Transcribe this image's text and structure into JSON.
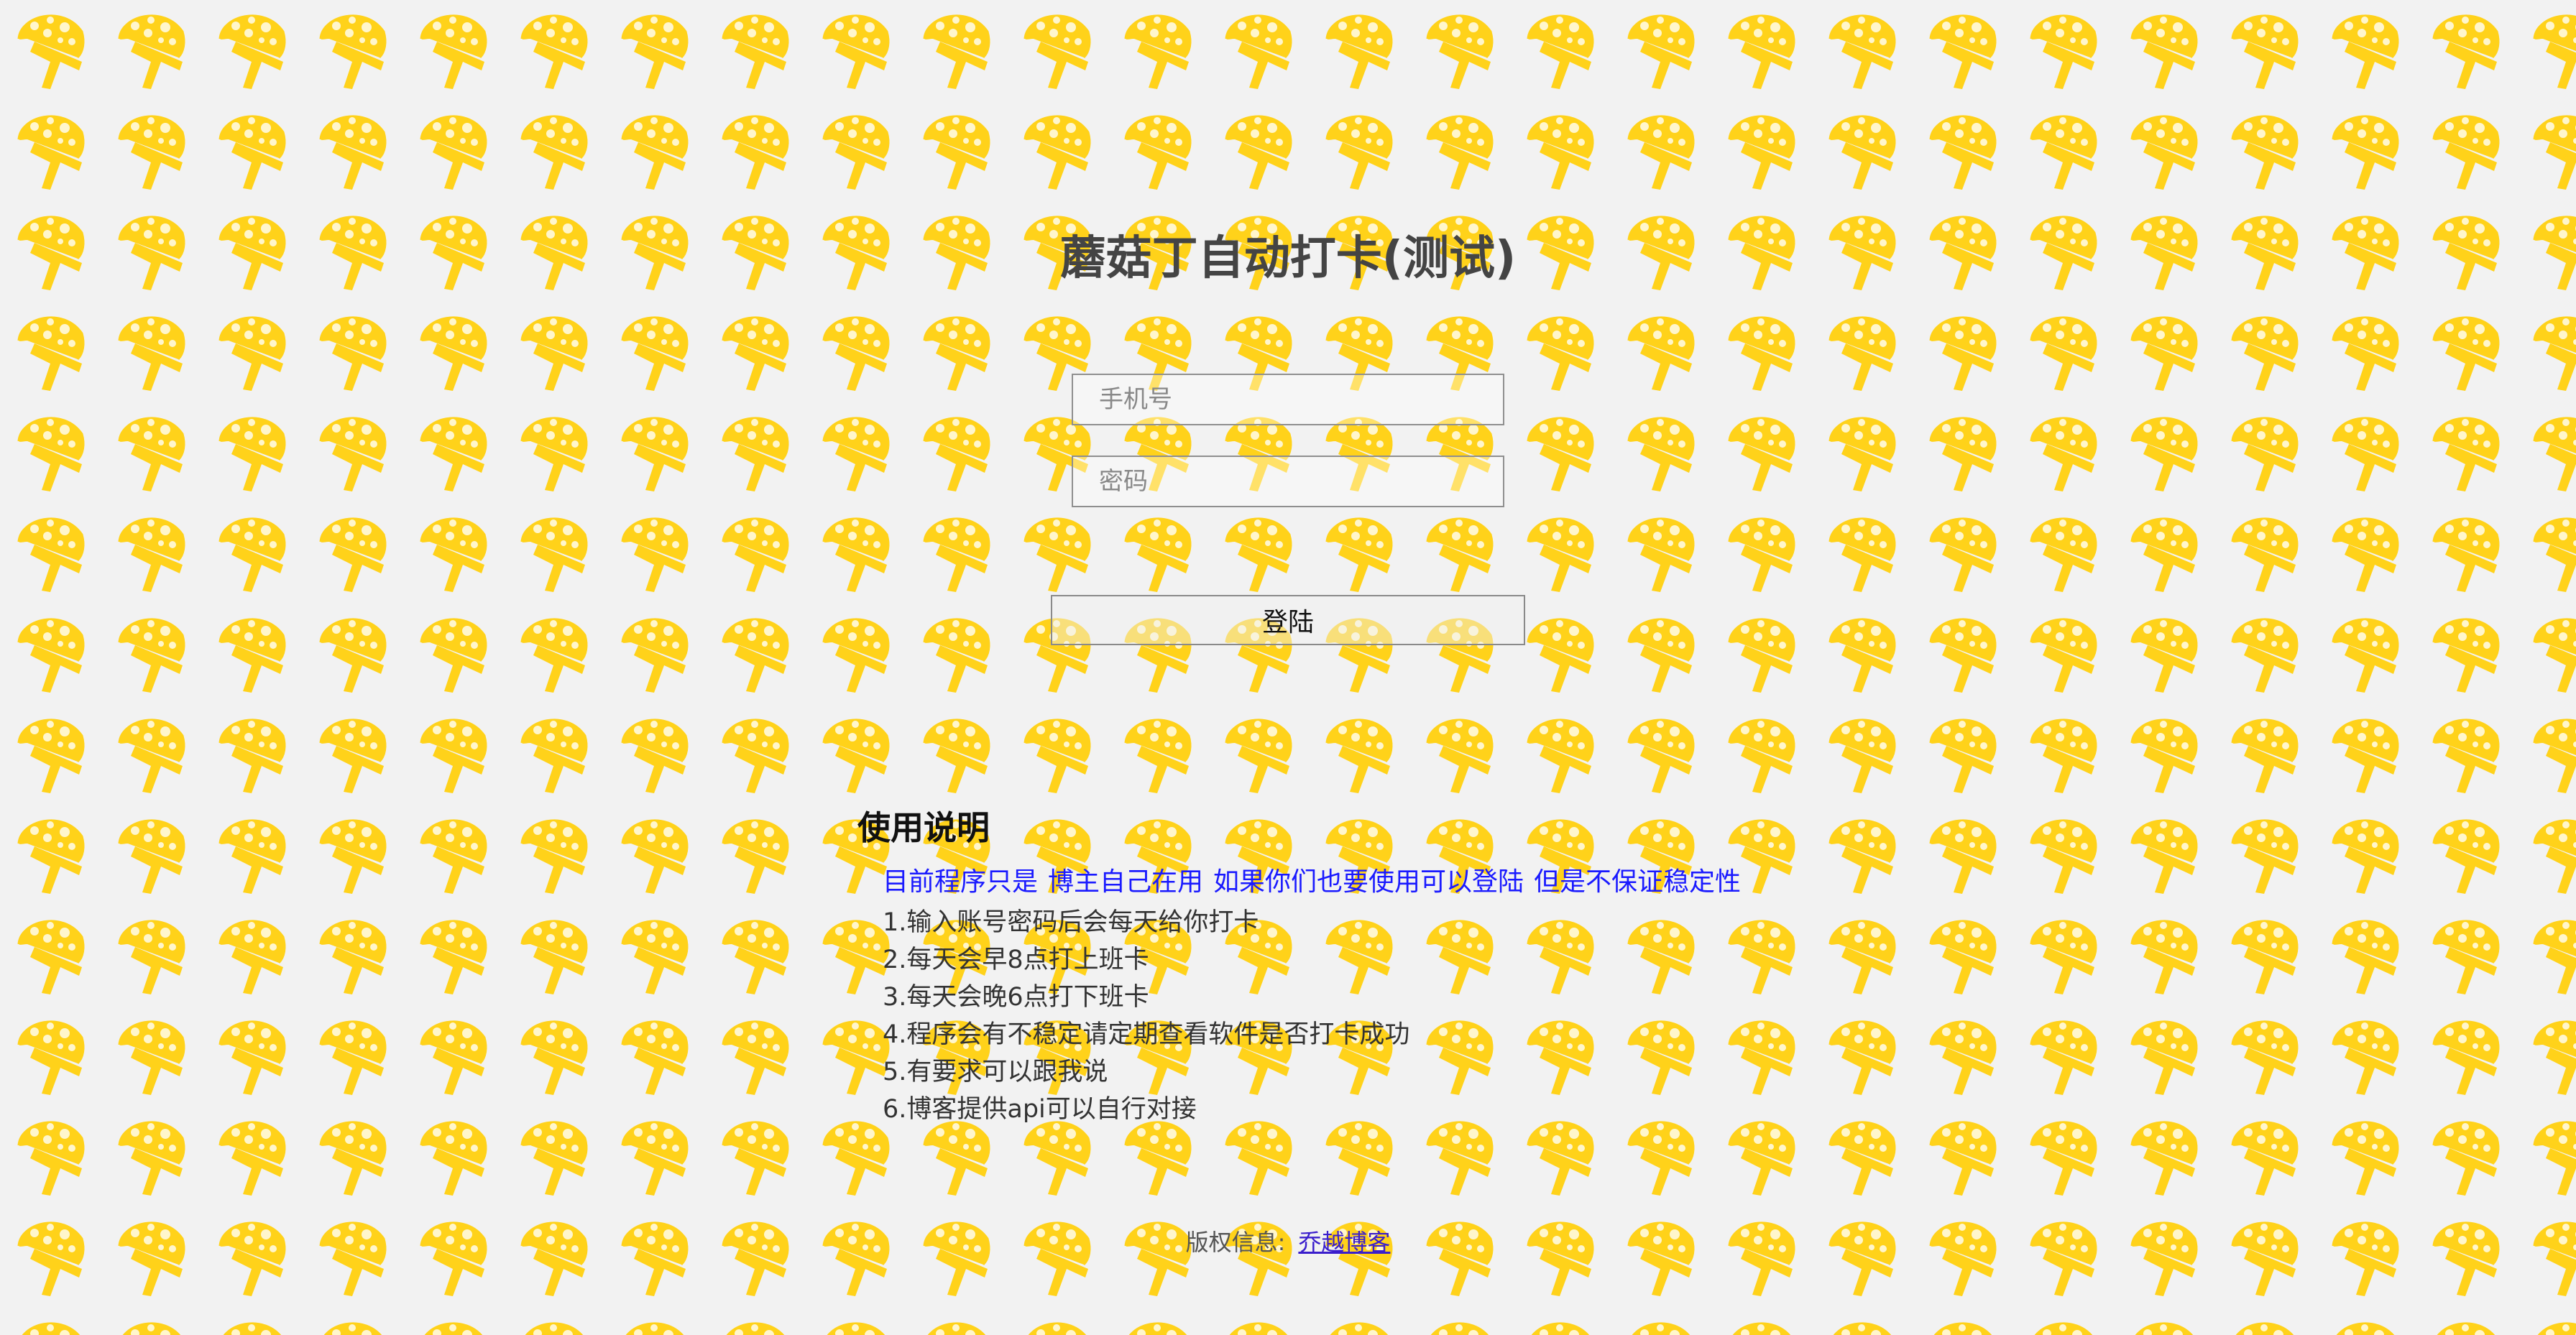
{
  "page": {
    "title": "蘑菇丁自动打卡(测试)"
  },
  "login_form": {
    "phone_placeholder": "手机号",
    "password_placeholder": "密码",
    "login_button": "登陆"
  },
  "instructions": {
    "heading": "使用说明",
    "notice_parts": [
      "目前程序只是",
      "博主自己在用",
      "如果你们也要使用可以登陆",
      "但是不保证稳定性"
    ],
    "items": [
      "1.输入账号密码后会每天给你打卡",
      "2.每天会早8点打上班卡",
      "3.每天会晚6点打下班卡",
      "4.程序会有不稳定请定期查看软件是否打卡成功",
      "5.有要求可以跟我说",
      "6.博客提供api可以自行对接"
    ]
  },
  "footer": {
    "copyright_label": "版权信息:",
    "blog_link": "乔越博客"
  },
  "colors": {
    "background": "#f2f2f2",
    "mushroom": "#ffd21a",
    "notice_text": "#1a1aff",
    "link": "#3a1ecc"
  },
  "background_icon": "mushroom-icon"
}
